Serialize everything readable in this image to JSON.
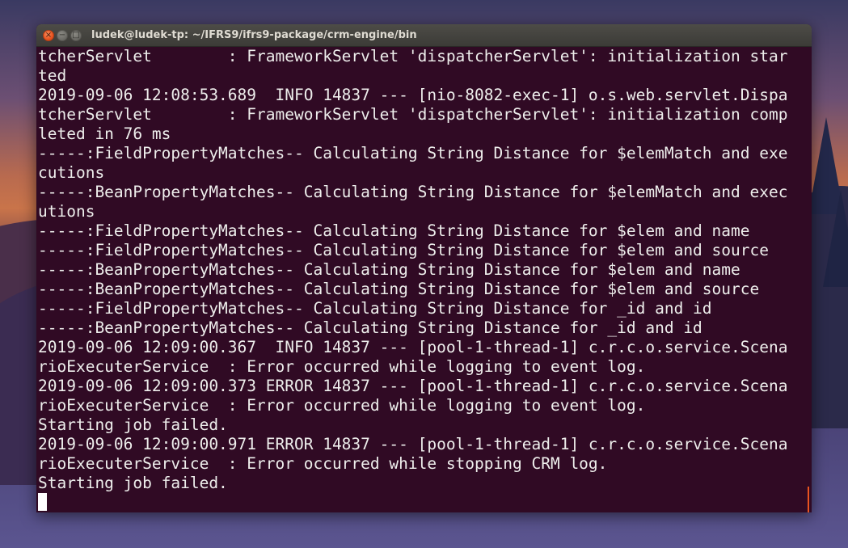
{
  "window": {
    "title": "ludek@ludek-tp: ~/IFRS9/ifrs9-package/crm-engine/bin",
    "controls": {
      "close_glyph": "×",
      "minimize_glyph": "−",
      "maximize_glyph": "□"
    }
  },
  "terminal": {
    "lines": [
      "tcherServlet        : FrameworkServlet 'dispatcherServlet': initialization star",
      "ted",
      "2019-09-06 12:08:53.689  INFO 14837 --- [nio-8082-exec-1] o.s.web.servlet.Dispa",
      "tcherServlet        : FrameworkServlet 'dispatcherServlet': initialization comp",
      "leted in 76 ms",
      "-----:FieldPropertyMatches-- Calculating String Distance for $elemMatch and exe",
      "cutions",
      "-----:BeanPropertyMatches-- Calculating String Distance for $elemMatch and exec",
      "utions",
      "-----:FieldPropertyMatches-- Calculating String Distance for $elem and name",
      "-----:FieldPropertyMatches-- Calculating String Distance for $elem and source",
      "-----:BeanPropertyMatches-- Calculating String Distance for $elem and name",
      "-----:BeanPropertyMatches-- Calculating String Distance for $elem and source",
      "-----:FieldPropertyMatches-- Calculating String Distance for _id and id",
      "-----:BeanPropertyMatches-- Calculating String Distance for _id and id",
      "2019-09-06 12:09:00.367  INFO 14837 --- [pool-1-thread-1] c.r.c.o.service.Scena",
      "rioExecuterService  : Error occurred while logging to event log.",
      "2019-09-06 12:09:00.373 ERROR 14837 --- [pool-1-thread-1] c.r.c.o.service.Scena",
      "rioExecuterService  : Error occurred while logging to event log.",
      "Starting job failed.",
      "2019-09-06 12:09:00.971 ERROR 14837 --- [pool-1-thread-1] c.r.c.o.service.Scena",
      "rioExecuterService  : Error occurred while stopping CRM log.",
      "Starting job failed."
    ]
  },
  "colors": {
    "terminal_background": "#300a24",
    "terminal_text": "#eeeeec",
    "accent": "#e95420"
  }
}
